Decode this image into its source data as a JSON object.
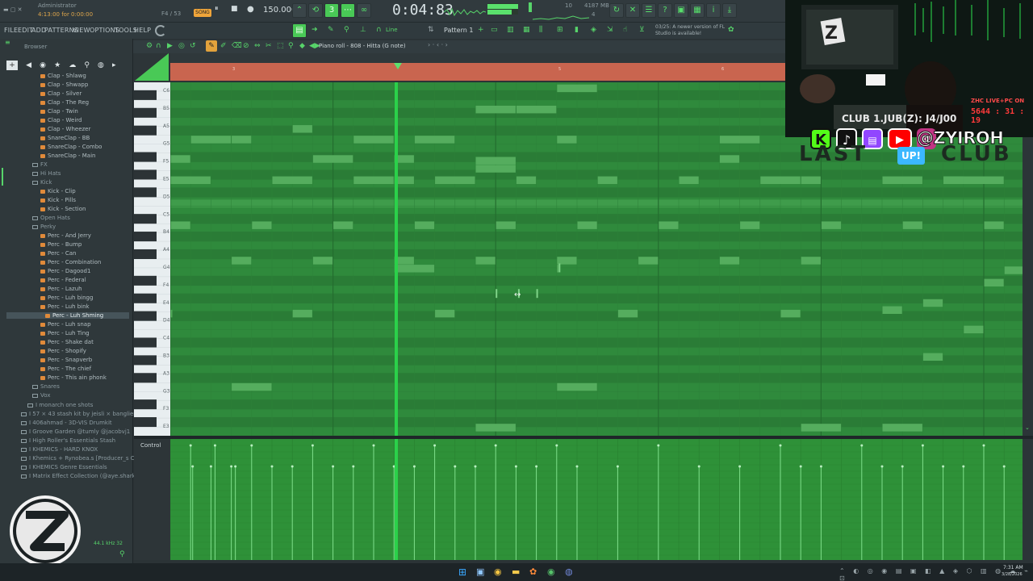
{
  "window": {
    "title": "Administrator",
    "time_small": "4:13:00 for 0:00:00",
    "pattern_counter": "F4 / 53",
    "song_label": "SONG",
    "tempo": "150.000",
    "time_display": "0:04:83",
    "cpu_label": "4187 MB",
    "mem_value": "10",
    "mem_sub": "4",
    "notice": "03/25: A newer version of FL Studio is available!"
  },
  "menu": [
    "FILE",
    "EDIT",
    "ADD",
    "PATTERNS",
    "VIEW",
    "OPTIONS",
    "TOOLS",
    "HELP"
  ],
  "toolbar": {
    "line_label": "Line",
    "pattern_label": "Pattern 1"
  },
  "browser": {
    "header": "Browser",
    "items": [
      {
        "label": "Clap - Shlawg",
        "type": "file"
      },
      {
        "label": "Clap - Shwapp",
        "type": "file"
      },
      {
        "label": "Clap - Silver",
        "type": "file"
      },
      {
        "label": "Clap - The Reg",
        "type": "file"
      },
      {
        "label": "Clap - Twin",
        "type": "file"
      },
      {
        "label": "Clap - Weird",
        "type": "file"
      },
      {
        "label": "Clap - Wheezer",
        "type": "file"
      },
      {
        "label": "SnareClap - BB",
        "type": "file"
      },
      {
        "label": "SnareClap - Combo",
        "type": "file"
      },
      {
        "label": "SnareClap - Main",
        "type": "file"
      },
      {
        "label": "FX",
        "type": "folder"
      },
      {
        "label": "Hi Hats",
        "type": "folder"
      },
      {
        "label": "Kick",
        "type": "folder-open"
      },
      {
        "label": "Kick - Clip",
        "type": "file"
      },
      {
        "label": "Kick - Pills",
        "type": "file"
      },
      {
        "label": "Kick - Section",
        "type": "file"
      },
      {
        "label": "Open Hats",
        "type": "folder"
      },
      {
        "label": "Perky",
        "type": "folder-open"
      },
      {
        "label": "Perc - And Jerry",
        "type": "file"
      },
      {
        "label": "Perc - Bump",
        "type": "file"
      },
      {
        "label": "Perc - Can",
        "type": "file"
      },
      {
        "label": "Perc - Combination",
        "type": "file"
      },
      {
        "label": "Perc - Dagood1",
        "type": "file"
      },
      {
        "label": "Perc - Federal",
        "type": "file"
      },
      {
        "label": "Perc - Lazuh",
        "type": "file"
      },
      {
        "label": "Perc - Luh bingg",
        "type": "file"
      },
      {
        "label": "Perc - Luh bink",
        "type": "file"
      },
      {
        "label": "Perc - Luh Shming",
        "type": "file-selected"
      },
      {
        "label": "Perc - Luh snap",
        "type": "file"
      },
      {
        "label": "Perc - Luh Ting",
        "type": "file"
      },
      {
        "label": "Perc - Shake dat",
        "type": "file"
      },
      {
        "label": "Perc - Shopify",
        "type": "file"
      },
      {
        "label": "Perc - Snapverb",
        "type": "file"
      },
      {
        "label": "Perc - The chief",
        "type": "file"
      },
      {
        "label": "Perc - This ain phonk",
        "type": "file"
      },
      {
        "label": "Snares",
        "type": "folder"
      },
      {
        "label": "Vox",
        "type": "folder"
      },
      {
        "label": "I monarch one shots",
        "type": "folder"
      },
      {
        "label": "I 57 × 43 stash kit by jeisli × banglienn",
        "type": "folder"
      },
      {
        "label": "I 406ahmad - 3D-VIS Drumkit",
        "type": "folder"
      },
      {
        "label": "I Groove Garden @tumly @jacobvj1",
        "type": "folder"
      },
      {
        "label": "I High Roller's Essentials Stash",
        "type": "folder"
      },
      {
        "label": "I KHEMICS - HARD KNOX",
        "type": "folder"
      },
      {
        "label": "I Khemics + Rynobea.s [Producer_s Cloud]",
        "type": "folder"
      },
      {
        "label": "I KHEMICS Genre Essentials",
        "type": "folder"
      },
      {
        "label": "I Matrix Effect Collection (@aye.shark)",
        "type": "folder"
      }
    ],
    "sample_info": "44.1 kHz 32"
  },
  "piano_roll": {
    "title": "Piano roll - 808 - Hitta (G note)",
    "bar_numbers": [
      "3",
      "5",
      "6"
    ],
    "key_labels": [
      "C6",
      "B5",
      "A5",
      "G5",
      "F5",
      "E5",
      "D5",
      "C5",
      "B4",
      "A4",
      "G4",
      "F4",
      "E4",
      "D4",
      "C4",
      "B3",
      "A3",
      "G3",
      "F3",
      "E3"
    ],
    "control_label": "Control"
  },
  "overlay": {
    "socials": "@ZYIROH",
    "live_label": "ZHC LIVE+PC ON",
    "timer": "5644 : 31 : 19",
    "club_text": "CLUB 1.JUB(Z): J4/J00",
    "bg_text_left": "LAST",
    "bg_text_right": "CLUB",
    "bg_badge": "UP!"
  },
  "taskbar": {
    "time": "7:31 AM",
    "date": "3/28/2026"
  },
  "colors": {
    "accent": "#4bd65c",
    "timeline": "#c9654f",
    "grid": "#2f8a3c",
    "note": "#4aa553"
  }
}
